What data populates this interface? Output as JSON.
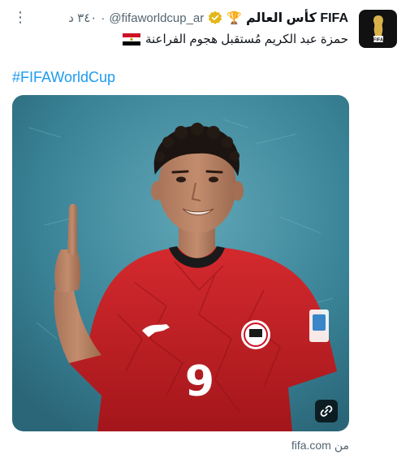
{
  "tweet": {
    "author_name": "كأس العالم FIFA",
    "trophy_emoji": "🏆",
    "handle": "@fifaworldcup_ar",
    "separator": "·",
    "timestamp": "٣٤٠ د",
    "more_label": "⋮",
    "text": "حمزة عبد الكريم مُستقبل هجوم الفراعنة",
    "hashtag": "#FIFAWorldCup",
    "avatar_label": "FIFA"
  },
  "media": {
    "jersey_number": "9",
    "link_icon": "link-icon"
  },
  "source": {
    "prefix": "من",
    "domain": "fifa.com"
  },
  "colors": {
    "link_blue": "#1d9bf0",
    "verified_gold": "#e2b719",
    "background_teal": "#3f8ea0",
    "jersey_red": "#c81e24"
  }
}
